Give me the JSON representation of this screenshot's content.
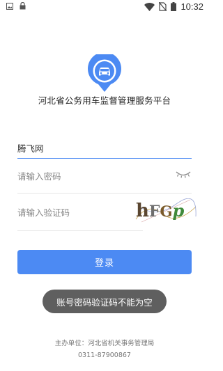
{
  "status_bar": {
    "time": "10:32",
    "left_icons": [
      "image-icon",
      "lock-icon"
    ],
    "right_icons": [
      "wifi-icon",
      "no-sim-icon",
      "battery-icon"
    ]
  },
  "app": {
    "logo_icon": "car-location-pin-icon",
    "title": "河北省公务用车监督管理服务平台"
  },
  "login": {
    "username_value": "腾飞网",
    "password_placeholder": "请输入密码",
    "captcha_placeholder": "请输入验证码",
    "captcha_text": "hFGp",
    "password_toggle_icon": "eye-closed-icon",
    "submit_label": "登录"
  },
  "toast": {
    "message": "账号密码验证码不能为空"
  },
  "footer": {
    "sponsor": "主办单位：河北省机关事务管理局",
    "phone": "0311-87900867"
  },
  "colors": {
    "accent": "#4c8af3",
    "toast_bg": "#5f5f5f"
  }
}
